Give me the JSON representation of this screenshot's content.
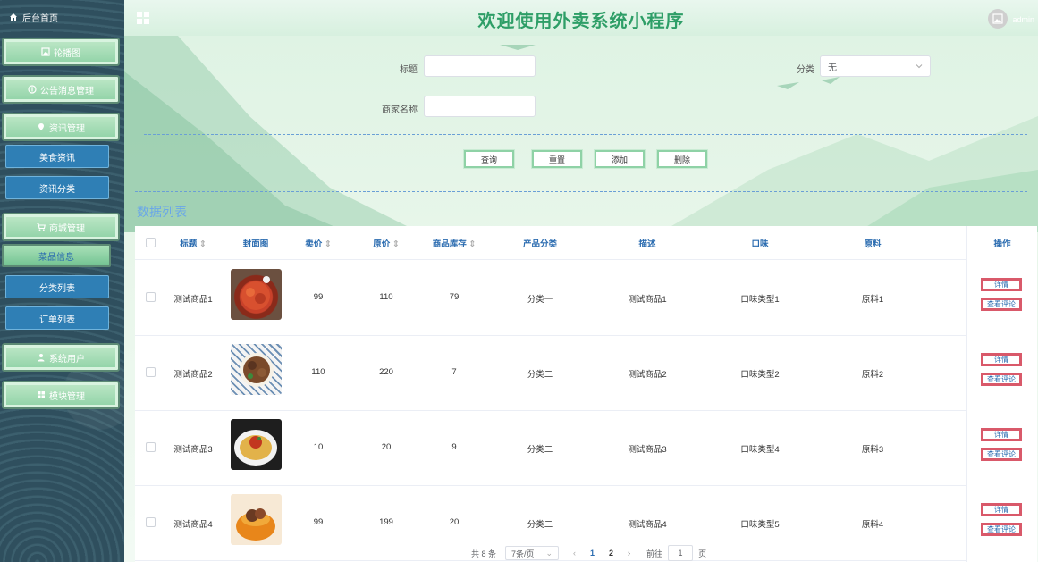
{
  "app": {
    "title": "欢迎使用外卖系统小程序",
    "user": "admin"
  },
  "sidebar": {
    "home": "后台首页",
    "items": [
      {
        "label": "轮播图",
        "icon": "image-icon"
      },
      {
        "label": "公告消息管理",
        "icon": "info-circle-icon"
      },
      {
        "label": "资讯管理",
        "icon": "location-pin-icon"
      },
      {
        "label": "美食资讯",
        "sub": true
      },
      {
        "label": "资讯分类",
        "sub": true
      },
      {
        "label": "商城管理",
        "icon": "cart-icon"
      },
      {
        "label": "菜品信息",
        "sub": true,
        "active": true
      },
      {
        "label": "分类列表",
        "sub": true
      },
      {
        "label": "订单列表",
        "sub": true
      },
      {
        "label": "系统用户",
        "icon": "user-icon"
      },
      {
        "label": "模块管理",
        "icon": "grid-icon"
      }
    ]
  },
  "search": {
    "title_label": "标题",
    "title_value": "",
    "category_label": "分类",
    "category_value": "无",
    "merchant_label": "商家名称",
    "merchant_value": "",
    "buttons": {
      "query": "查询",
      "reset": "重置",
      "add": "添加",
      "delete": "删除"
    }
  },
  "list": {
    "title": "数据列表",
    "columns": [
      "标题",
      "封面图",
      "卖价",
      "原价",
      "商品库存",
      "产品分类",
      "描述",
      "口味",
      "原料",
      "操作"
    ],
    "rows": [
      {
        "title": "测试商品1",
        "price": "99",
        "original": "110",
        "stock": "79",
        "category": "分类一",
        "desc": "测试商品1",
        "flavor": "口味类型1",
        "material": "原料1",
        "food": "food-crayfish"
      },
      {
        "title": "测试商品2",
        "price": "110",
        "original": "220",
        "stock": "7",
        "category": "分类二",
        "desc": "测试商品2",
        "flavor": "口味类型2",
        "material": "原料2",
        "food": "food-beef"
      },
      {
        "title": "测试商品3",
        "price": "10",
        "original": "20",
        "stock": "9",
        "category": "分类二",
        "desc": "测试商品3",
        "flavor": "口味类型4",
        "material": "原料3",
        "food": "food-pasta"
      },
      {
        "title": "测试商品4",
        "price": "99",
        "original": "199",
        "stock": "20",
        "category": "分类二",
        "desc": "测试商品4",
        "flavor": "口味类型5",
        "material": "原料4",
        "food": "food-pumpkin"
      }
    ],
    "actions": {
      "detail": "详情",
      "comments": "查看评论"
    }
  },
  "pagination": {
    "total": "共 8 条",
    "page_size": "7条/页",
    "pages": [
      "1",
      "2"
    ],
    "goto_prefix": "前往",
    "goto_value": "1",
    "goto_suffix": "页"
  },
  "colors": {
    "accent": "#2e9e67",
    "link": "#2b6cb0",
    "sidebar": "#2f4f5e"
  }
}
